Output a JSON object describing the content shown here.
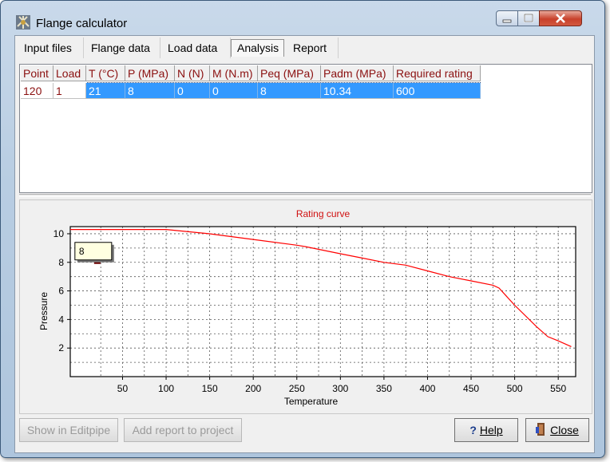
{
  "window": {
    "title": "Flange calculator"
  },
  "tabs": [
    "Input files",
    "Flange data",
    "Load data",
    "Analysis",
    "Report"
  ],
  "active_tab": "Analysis",
  "table": {
    "columns": [
      "Point",
      "Load",
      "T (°C)",
      "P (MPa)",
      "N (N)",
      "M (N.m)",
      "Peq (MPa)",
      "Padm (MPa)",
      "Required rating"
    ],
    "rows": [
      [
        "120",
        "1",
        "21",
        "8",
        "0",
        "0",
        "8",
        "10.34",
        "600"
      ]
    ]
  },
  "chart_data": {
    "type": "line",
    "title": "Rating curve",
    "xlabel": "Temperature",
    "ylabel": "Pressure",
    "xlim": [
      -10,
      570
    ],
    "ylim": [
      0,
      10.5
    ],
    "xticks": [
      50,
      100,
      150,
      200,
      250,
      300,
      350,
      400,
      450,
      500,
      550
    ],
    "yticks": [
      2,
      4,
      6,
      8,
      10
    ],
    "grid": true,
    "series": [
      {
        "x": [
          -10,
          38,
          100,
          150,
          200,
          250,
          260,
          300,
          325,
          350,
          375,
          400,
          425,
          450,
          475,
          482,
          500,
          525,
          538,
          550,
          565
        ],
        "y": [
          10.3,
          10.3,
          10.3,
          10.0,
          9.6,
          9.2,
          9.1,
          8.6,
          8.3,
          8.0,
          7.8,
          7.4,
          7.0,
          6.7,
          6.4,
          6.2,
          5.0,
          3.5,
          2.8,
          2.5,
          2.1
        ],
        "color": "#ff0000"
      }
    ],
    "marker": {
      "x": 21,
      "y": 8,
      "label": "8"
    }
  },
  "buttons": {
    "show_in_editpipe": "Show in Editpipe",
    "add_report": "Add report to project",
    "help": "Help",
    "help_icon": "?",
    "close": "Close"
  }
}
